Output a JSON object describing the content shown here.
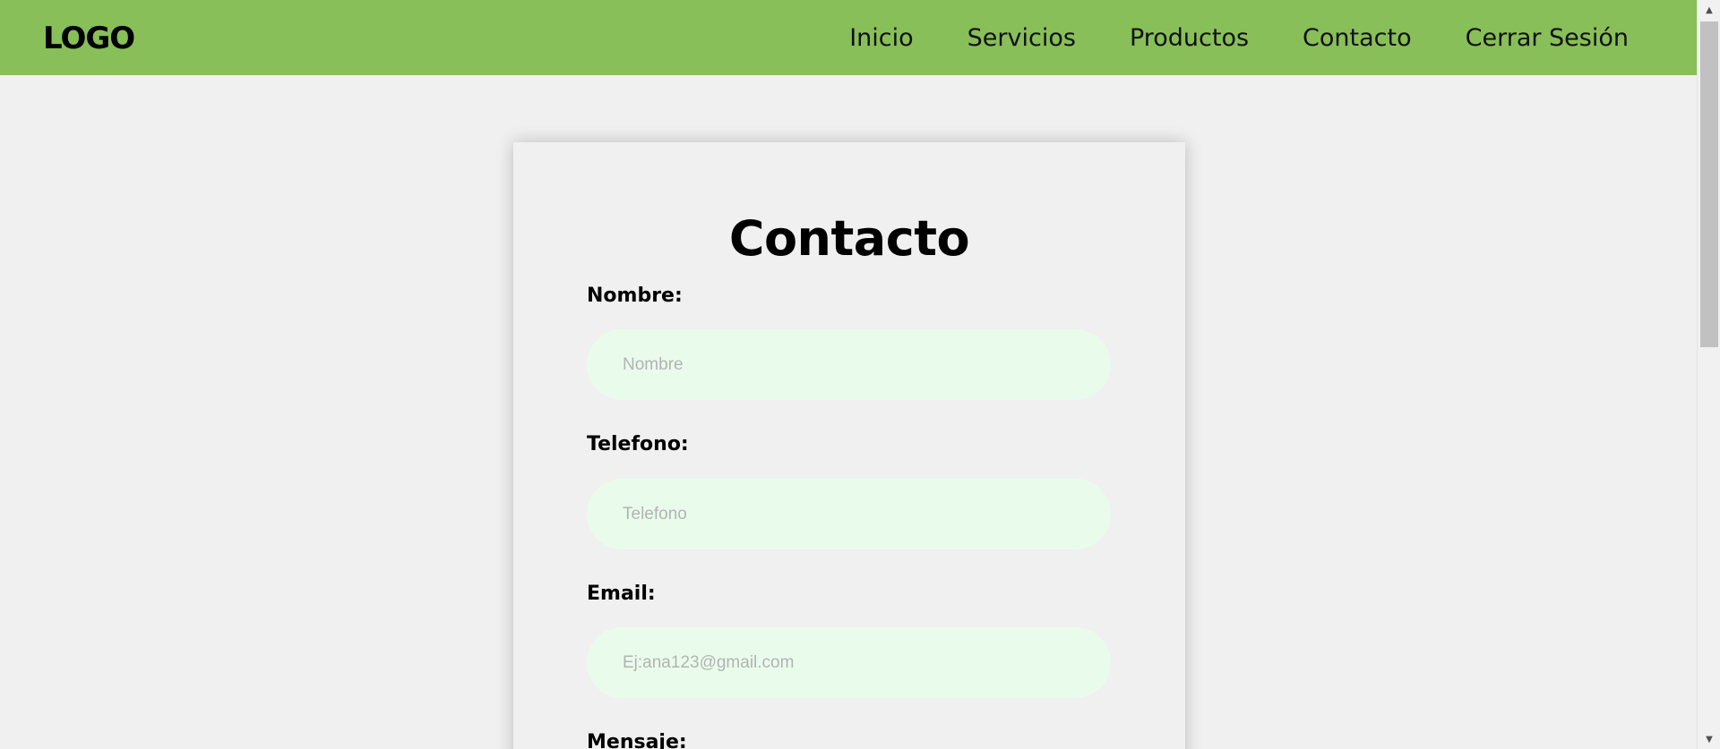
{
  "header": {
    "logo": "LOGO",
    "nav": [
      "Inicio",
      "Servicios",
      "Productos",
      "Contacto",
      "Cerrar Sesión"
    ]
  },
  "form": {
    "title": "Contacto",
    "fields": [
      {
        "label": "Nombre:",
        "placeholder": "Nombre"
      },
      {
        "label": "Telefono:",
        "placeholder": "Telefono"
      },
      {
        "label": "Email:",
        "placeholder": "Ej:ana123@gmail.com"
      },
      {
        "label": "Mensaje:"
      }
    ]
  },
  "colors": {
    "header_bg": "#88bf59",
    "page_bg": "#f0f0f0",
    "input_bg": "#e9fcec"
  },
  "icons": {
    "scroll_up": "triangle-up-icon",
    "scroll_down": "triangle-down-icon"
  }
}
